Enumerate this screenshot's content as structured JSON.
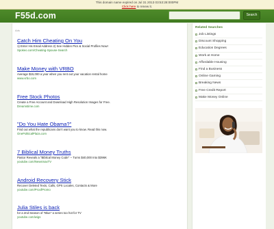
{
  "notice": {
    "line1": "This domain name expired on Jul 31 2013 03:53:28:000PM",
    "link": "Click here",
    "line2_suffix": " to renew it."
  },
  "header": {
    "logo": "F55d.com",
    "search_placeholder": "",
    "search_button": "Search"
  },
  "main": {
    "ads_label": "Ads",
    "results": [
      {
        "title": "Catch Him Cheating On You",
        "desc": "1) Enter His Email Address 2) See Hidden Pics & Social Profiles Now!",
        "url": "Spokeo.com/Cheating-Spouse-Search"
      },
      {
        "title": "Make Money with VRBO",
        "desc": "Average $15,000 a year when you rent out your vacation rental home",
        "url": "www.vrbo.com"
      },
      {
        "title": "Free Stock Photos",
        "desc": "Create a Free Account and Download High Resolution Images for Free.",
        "url": "Dreamstime.com"
      },
      {
        "title": "\"Do You Hate Obama?\"",
        "desc": "Find out what the republicans don't want you to know. Read this now.",
        "url": "OnePoliticalPlaza.com"
      },
      {
        "title": "7 Biblical Money Truths",
        "desc": "Pastor Reveals a \"Biblical Money Code\" -- Turns $40,000 Into $396K",
        "url": "youtube.com/NewsmaxTV"
      },
      {
        "title": "Android Recovery Stick",
        "desc": "Recover Deleted Texts, Calls, GPS Locales, Contacts & More",
        "url": "youtube.com/ProofPromo"
      },
      {
        "title": "Julia Stiles is back",
        "desc": "for a 2nd Season of \"Blue\" a series too hot for TV",
        "url": "youtube.com/wigs"
      }
    ]
  },
  "sidebar": {
    "heading": "Related Searches",
    "items": [
      "Job Listings",
      "Discount Shopping",
      "Education Degrees",
      "Work at Home",
      "Affordable Housing",
      "Find a Business",
      "Online Gaming",
      "Breaking News",
      "Free Credit Report",
      "Make Money Online"
    ]
  }
}
